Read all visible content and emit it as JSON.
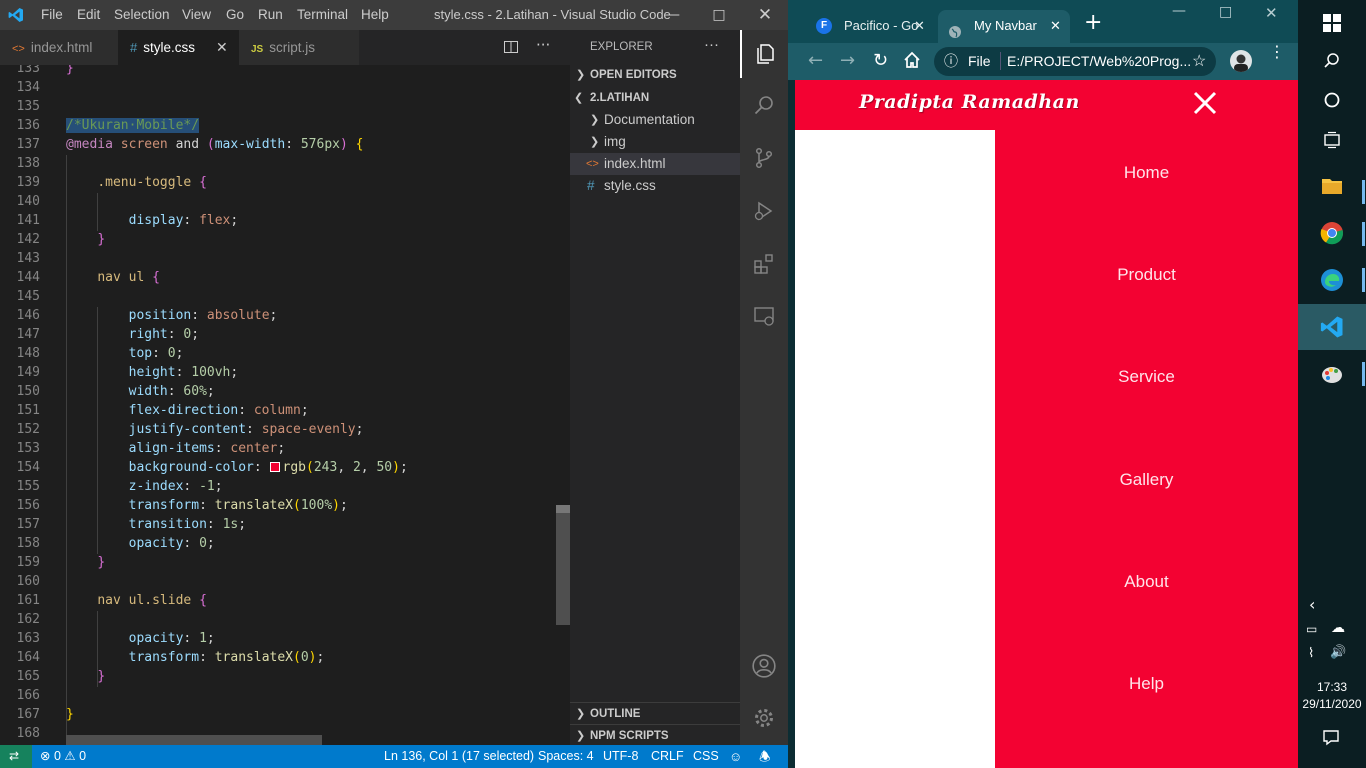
{
  "vscode": {
    "menu": [
      "File",
      "Edit",
      "Selection",
      "View",
      "Go",
      "Run",
      "Terminal",
      "Help"
    ],
    "window_title": "style.css - 2.Latihan - Visual Studio Code",
    "tabs": [
      {
        "label": "index.html",
        "icon": "<>",
        "active": false
      },
      {
        "label": "style.css",
        "icon": "#",
        "active": true
      },
      {
        "label": "script.js",
        "icon": "JS",
        "active": false
      }
    ],
    "editor_lines": [
      {
        "n": "133",
        "html": "<span class='c-b2'>}</span>"
      },
      {
        "n": "134",
        "html": ""
      },
      {
        "n": "135",
        "html": ""
      },
      {
        "n": "136",
        "html": "<span class='c-com c-sel'>/*Ukuran·Mobile*/</span>"
      },
      {
        "n": "137",
        "html": "<span class='c-at'>@media</span> <span class='c-val'>screen</span> <span class='c-pl'>and</span> <span class='c-b2'>(</span><span class='c-prop'>max-width</span><span class='c-pl'>: </span><span class='c-num'>576px</span><span class='c-b2'>)</span> <span class='c-b1'>{</span>"
      },
      {
        "n": "138",
        "html": ""
      },
      {
        "n": "139",
        "html": "    <span class='c-sel2'>.menu-toggle</span> <span class='c-b2'>{</span>"
      },
      {
        "n": "140",
        "html": ""
      },
      {
        "n": "141",
        "html": "        <span class='c-prop'>display</span><span class='c-pl'>: </span><span class='c-val'>flex</span><span class='c-pl'>;</span>"
      },
      {
        "n": "142",
        "html": "    <span class='c-b2'>}</span>"
      },
      {
        "n": "143",
        "html": ""
      },
      {
        "n": "144",
        "html": "    <span class='c-sel2'>nav ul</span> <span class='c-b2'>{</span>"
      },
      {
        "n": "145",
        "html": ""
      },
      {
        "n": "146",
        "html": "        <span class='c-prop'>position</span><span class='c-pl'>: </span><span class='c-val'>absolute</span><span class='c-pl'>;</span>"
      },
      {
        "n": "147",
        "html": "        <span class='c-prop'>right</span><span class='c-pl'>: </span><span class='c-num'>0</span><span class='c-pl'>;</span>"
      },
      {
        "n": "148",
        "html": "        <span class='c-prop'>top</span><span class='c-pl'>: </span><span class='c-num'>0</span><span class='c-pl'>;</span>"
      },
      {
        "n": "149",
        "html": "        <span class='c-prop'>height</span><span class='c-pl'>: </span><span class='c-num'>100vh</span><span class='c-pl'>;</span>"
      },
      {
        "n": "150",
        "html": "        <span class='c-prop'>width</span><span class='c-pl'>: </span><span class='c-num'>60%</span><span class='c-pl'>;</span>"
      },
      {
        "n": "151",
        "html": "        <span class='c-prop'>flex-direction</span><span class='c-pl'>: </span><span class='c-val'>column</span><span class='c-pl'>;</span>"
      },
      {
        "n": "152",
        "html": "        <span class='c-prop'>justify-content</span><span class='c-pl'>: </span><span class='c-val'>space-evenly</span><span class='c-pl'>;</span>"
      },
      {
        "n": "153",
        "html": "        <span class='c-prop'>align-items</span><span class='c-pl'>: </span><span class='c-val'>center</span><span class='c-pl'>;</span>"
      },
      {
        "n": "154",
        "html": "        <span class='c-prop'>background-color</span><span class='c-pl'>: </span><span style='display:inline-block;width:10px;height:10px;background:rgb(243,2,50);border:1px solid #fff;margin-right:3px;vertical-align:-1px'></span><span class='c-fn'>rgb</span><span class='c-b1'>(</span><span class='c-num'>243</span><span class='c-pl'>, </span><span class='c-num'>2</span><span class='c-pl'>, </span><span class='c-num'>50</span><span class='c-b1'>)</span><span class='c-pl'>;</span>"
      },
      {
        "n": "155",
        "html": "        <span class='c-prop'>z-index</span><span class='c-pl'>: </span><span class='c-num'>-1</span><span class='c-pl'>;</span>"
      },
      {
        "n": "156",
        "html": "        <span class='c-prop'>transform</span><span class='c-pl'>: </span><span class='c-fn'>translateX</span><span class='c-b1'>(</span><span class='c-num'>100%</span><span class='c-b1'>)</span><span class='c-pl'>;</span>"
      },
      {
        "n": "157",
        "html": "        <span class='c-prop'>transition</span><span class='c-pl'>: </span><span class='c-num'>1s</span><span class='c-pl'>;</span>"
      },
      {
        "n": "158",
        "html": "        <span class='c-prop'>opacity</span><span class='c-pl'>: </span><span class='c-num'>0</span><span class='c-pl'>;</span>"
      },
      {
        "n": "159",
        "html": "    <span class='c-b2'>}</span>"
      },
      {
        "n": "160",
        "html": ""
      },
      {
        "n": "161",
        "html": "    <span class='c-sel2'>nav ul.slide</span> <span class='c-b2'>{</span>"
      },
      {
        "n": "162",
        "html": ""
      },
      {
        "n": "163",
        "html": "        <span class='c-prop'>opacity</span><span class='c-pl'>: </span><span class='c-num'>1</span><span class='c-pl'>;</span>"
      },
      {
        "n": "164",
        "html": "        <span class='c-prop'>transform</span><span class='c-pl'>: </span><span class='c-fn'>translateX</span><span class='c-b1'>(</span><span class='c-num'>0</span><span class='c-b1'>)</span><span class='c-pl'>;</span>"
      },
      {
        "n": "165",
        "html": "    <span class='c-b2'>}</span>"
      },
      {
        "n": "166",
        "html": ""
      },
      {
        "n": "167",
        "html": "<span class='c-b1'>}</span>"
      },
      {
        "n": "168",
        "html": ""
      }
    ],
    "explorer": {
      "title": "EXPLORER",
      "open_editors": "OPEN EDITORS",
      "folder": "2.LATIHAN",
      "items": [
        {
          "label": "Documentation",
          "type": "folder"
        },
        {
          "label": "img",
          "type": "folder"
        },
        {
          "label": "index.html",
          "type": "html",
          "selected": true
        },
        {
          "label": "style.css",
          "type": "css",
          "selected": false
        }
      ],
      "outline": "OUTLINE",
      "npm": "NPM SCRIPTS"
    },
    "status": {
      "errors": "0",
      "warnings": "0",
      "position": "Ln 136, Col 1 (17 selected)",
      "spaces": "Spaces: 4",
      "encoding": "UTF-8",
      "eol": "CRLF",
      "language": "CSS"
    }
  },
  "chrome": {
    "tabs": [
      {
        "label": "Pacifico - Go",
        "favicon": "F",
        "active": false
      },
      {
        "label": "My Navbar",
        "favicon": "globe",
        "active": true
      }
    ],
    "url_scheme": "File",
    "url": "E:/PROJECT/Web%20Prog..."
  },
  "site": {
    "brand": "Pradipta Ramadhan",
    "nav_links": [
      "Home",
      "Product",
      "Service",
      "Gallery",
      "About",
      "Help"
    ],
    "accent": "#f30232"
  },
  "taskbar": {
    "time": "17:33",
    "date": "29/11/2020"
  }
}
